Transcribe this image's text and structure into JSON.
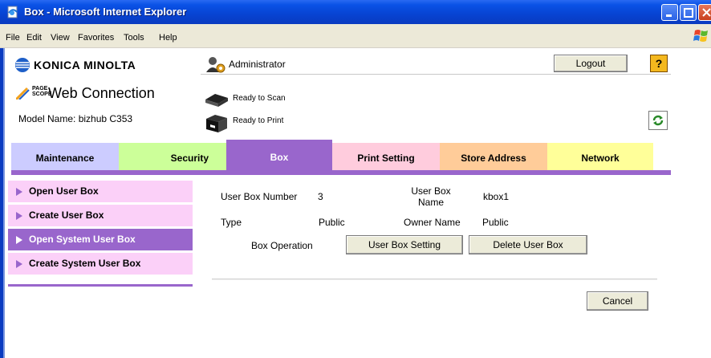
{
  "window": {
    "title": "Box - Microsoft Internet Explorer"
  },
  "menu": [
    "File",
    "Edit",
    "View",
    "Favorites",
    "Tools",
    "Help"
  ],
  "header": {
    "brand": "KONICA MINOLTA",
    "pagescope_top": "PAGE",
    "pagescope_bottom": "SCOPE",
    "product": "Web Connection",
    "model_label": "Model Name: bizhub C353",
    "user": "Administrator",
    "logout_label": "Logout",
    "help_label": "?",
    "scan_status": "Ready to Scan",
    "print_status": "Ready to Print"
  },
  "tabs": [
    {
      "label": "Maintenance",
      "color": "#ccccff"
    },
    {
      "label": "Security",
      "color": "#ccff99"
    },
    {
      "label": "Box",
      "color": "#9966cc",
      "active": true
    },
    {
      "label": "Print Setting",
      "color": "#ffccdd"
    },
    {
      "label": "Store Address",
      "color": "#ffcc99"
    },
    {
      "label": "Network",
      "color": "#ffff99"
    }
  ],
  "nav": [
    {
      "label": "Open User Box"
    },
    {
      "label": "Create User Box"
    },
    {
      "label": "Open System User Box",
      "active": true
    },
    {
      "label": "Create System User Box"
    }
  ],
  "box": {
    "number_label": "User Box Number",
    "number_value": "3",
    "name_label": "User Box Name",
    "name_value": "kbox1",
    "type_label": "Type",
    "type_value": "Public",
    "owner_label": "Owner Name",
    "owner_value": "Public",
    "operation_label": "Box Operation",
    "setting_button": "User Box Setting",
    "delete_button": "Delete User Box",
    "cancel_button": "Cancel"
  },
  "colors": {
    "accent": "#9966cc",
    "nav_bg": "#fbd0f8",
    "titlebar": "#0a52e6"
  }
}
